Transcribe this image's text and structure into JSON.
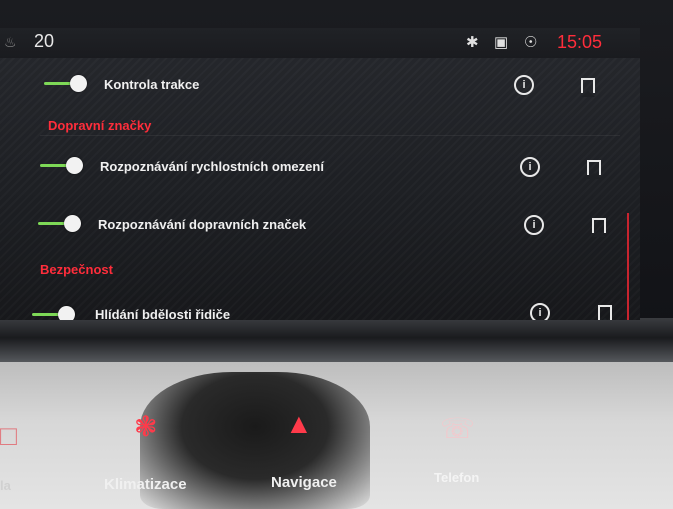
{
  "status": {
    "temperature": "20",
    "clock": "15:05",
    "icons": [
      "bluetooth-icon",
      "radio-icon",
      "location-icon"
    ]
  },
  "settings": {
    "rows": [
      {
        "label": "Kontrola trakce"
      },
      {
        "label": "Rozpoznávání rychlostních omezení"
      },
      {
        "label": "Rozpoznávání dopravních značek"
      },
      {
        "label": "Hlídání bdělosti řidiče"
      }
    ],
    "sections": [
      "Dopravní značky",
      "Bezpečnost"
    ]
  },
  "panel": {
    "buttons": [
      "Klimatizace",
      "Navigace",
      "Telefon"
    ],
    "partial_left": "la"
  },
  "colors": {
    "accent": "#ff2d3b",
    "toggle_on": "#7ed957"
  }
}
